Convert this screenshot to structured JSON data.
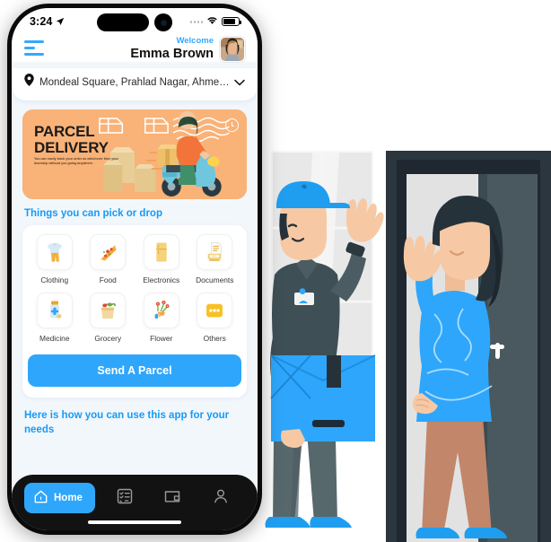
{
  "status_bar": {
    "time": "3:24",
    "location_icon": "location-arrow-icon",
    "signal_icon": "cellular-signal-icon",
    "wifi_icon": "wifi-icon",
    "battery_icon": "battery-icon"
  },
  "header": {
    "menu_icon": "hamburger-menu-icon",
    "welcome_label": "Welcome",
    "user_name": "Emma Brown",
    "avatar_icon": "user-avatar"
  },
  "location": {
    "pin_icon": "map-pin-icon",
    "address": "Mondeal Square, Prahlad Nagar, Ahme…",
    "chevron_icon": "chevron-down-icon"
  },
  "banner": {
    "title_line1": "PARCEL",
    "title_line2": "DELIVERY",
    "subtitle": "You can easily track your order as whichever time your doorstep without you going anywhere.",
    "clock_icon": "clock-icon",
    "bg_color": "#f9b277"
  },
  "categories_section": {
    "title": "Things you can pick or drop",
    "items": [
      {
        "label": "Clothing",
        "icon": "clothing-icon"
      },
      {
        "label": "Food",
        "icon": "pizza-icon"
      },
      {
        "label": "Electronics",
        "icon": "refrigerator-icon"
      },
      {
        "label": "Documents",
        "icon": "printer-documents-icon"
      },
      {
        "label": "Medicine",
        "icon": "medicine-bottle-icon"
      },
      {
        "label": "Grocery",
        "icon": "grocery-bag-icon"
      },
      {
        "label": "Flower",
        "icon": "flower-bouquet-icon"
      },
      {
        "label": "Others",
        "icon": "more-dots-icon"
      }
    ]
  },
  "cta": {
    "label": "Send A Parcel"
  },
  "footer_section": {
    "title": "Here is how you can use this app for your needs"
  },
  "bottom_nav": {
    "items": [
      {
        "label": "Home",
        "icon": "home-icon",
        "active": true
      },
      {
        "label": "",
        "icon": "orders-list-icon",
        "active": false
      },
      {
        "label": "",
        "icon": "wallet-icon",
        "active": false
      },
      {
        "label": "",
        "icon": "profile-person-icon",
        "active": false
      }
    ]
  },
  "illustration": {
    "name": "delivery-man-and-woman-at-door-illustration",
    "courier_label": "delivery-courier-with-parcel",
    "customer_label": "customer-woman-waving",
    "door_label": "front-door"
  },
  "colors": {
    "accent": "#2ea6fb",
    "accent_text": "#179af5",
    "banner": "#f9b277",
    "nav_bg": "#121212",
    "app_bg": "#f2f7fc"
  }
}
